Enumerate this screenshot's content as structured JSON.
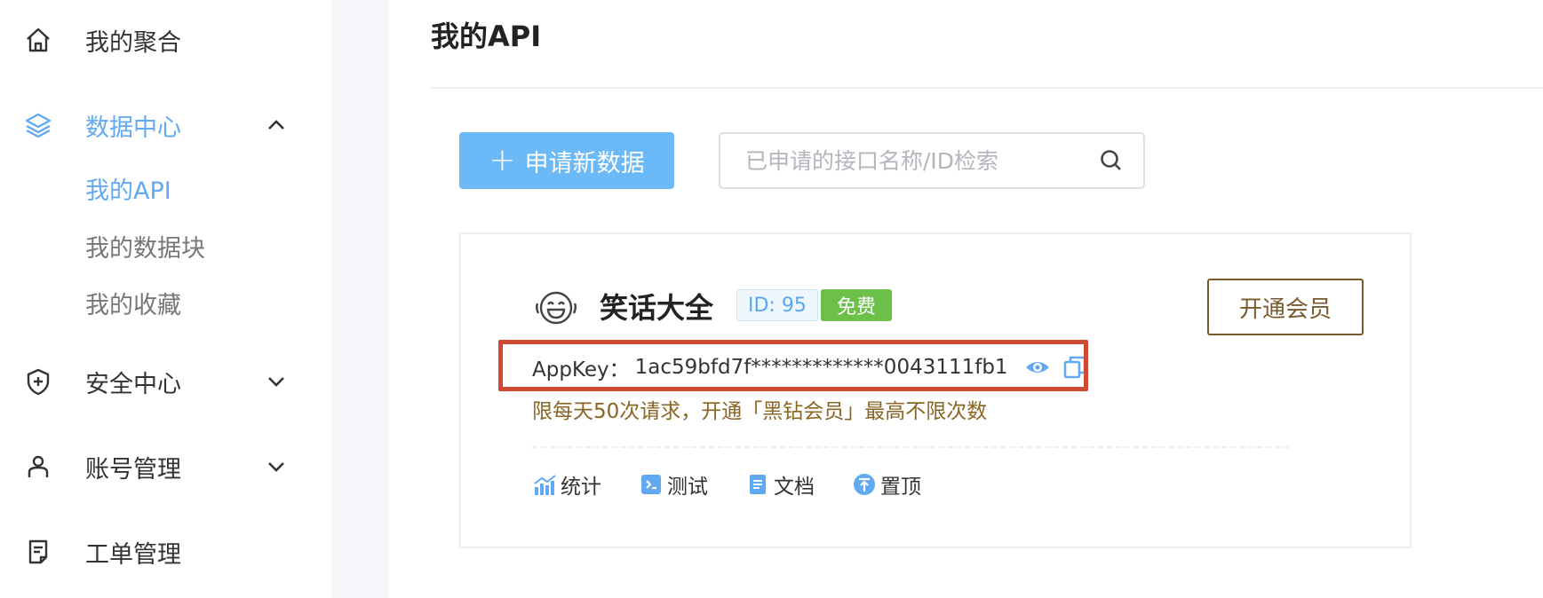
{
  "sidebar": {
    "items": [
      {
        "label": "我的聚合",
        "icon": "home-icon"
      },
      {
        "label": "数据中心",
        "icon": "layers-icon",
        "expanded": true,
        "children": [
          {
            "label": "我的API",
            "active": true
          },
          {
            "label": "我的数据块"
          },
          {
            "label": "我的收藏"
          }
        ]
      },
      {
        "label": "安全中心",
        "icon": "shield-plus-icon"
      },
      {
        "label": "账号管理",
        "icon": "user-icon"
      },
      {
        "label": "工单管理",
        "icon": "ticket-icon"
      }
    ]
  },
  "main": {
    "title": "我的API",
    "apply_button": "申请新数据",
    "search": {
      "placeholder": "已申请的接口名称/ID检索",
      "value": ""
    }
  },
  "api_card": {
    "name": "笑话大全",
    "id_label": "ID: 95",
    "tag": "免费",
    "vip_button": "开通会员",
    "appkey_label": "AppKey：",
    "appkey_value": "1ac59bfd7f*************0043111fb1",
    "limit_note": "限每天50次请求，开通「黑钻会员」最高不限次数",
    "actions": [
      {
        "label": "统计",
        "icon": "stats-icon"
      },
      {
        "label": "测试",
        "icon": "terminal-icon"
      },
      {
        "label": "文档",
        "icon": "document-icon"
      },
      {
        "label": "置顶",
        "icon": "pin-top-icon"
      }
    ]
  },
  "colors": {
    "accent": "#62a9f3",
    "button_blue": "#6cb9f7",
    "free_green": "#6cc04a",
    "gold": "#7a5a2c",
    "highlight_red": "#d04a33"
  }
}
